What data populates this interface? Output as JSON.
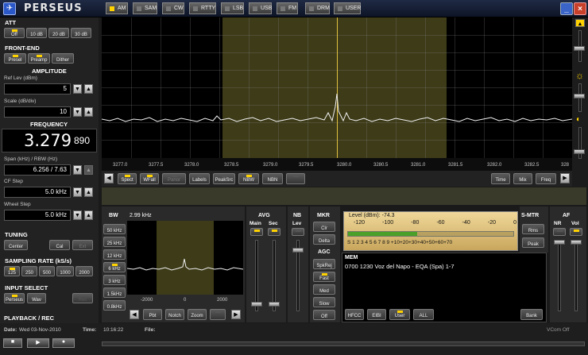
{
  "window": {
    "title": "PERSEUS",
    "min_glyph": "_",
    "close_glyph": "×"
  },
  "left": {
    "att": {
      "title": "ATT",
      "buttons": [
        "Off",
        "10 dB",
        "20 dB",
        "30 dB"
      ]
    },
    "frontend": {
      "title": "FRONT-END",
      "buttons": [
        "Presel",
        "Preamp",
        "Dither"
      ]
    },
    "amplitude": {
      "title": "AMPLITUDE",
      "ref_label": "Ref Lev (dBm)",
      "ref_value": "5",
      "scale_label": "Scale (dB/div)",
      "scale_value": "10"
    },
    "frequency": {
      "title": "FREQUENCY",
      "main": "3.279",
      "fine": "890",
      "span_label": "Span (kHz) / RBW (Hz)",
      "span_value": "6.256 / 7.63",
      "cf_label": "CF Step",
      "cf_value": "5.0 kHz",
      "wheel_label": "Wheel Step",
      "wheel_value": "5.0 kHz"
    },
    "tuning": {
      "title": "TUNING",
      "buttons": [
        "Center",
        "Cal",
        "Ext"
      ]
    },
    "sampling": {
      "title": "SAMPLING RATE (kS/s)",
      "buttons": [
        "125",
        "250",
        "500",
        "1000",
        "2000"
      ]
    },
    "input": {
      "title": "INPUT SELECT",
      "buttons": [
        "Perseus",
        "Wav",
        "Rec"
      ]
    }
  },
  "spectrum": {
    "ticks": [
      "3277.0",
      "3277.5",
      "3278.0",
      "3278.5",
      "3279.0",
      "3279.5",
      "3280.0",
      "3280.5",
      "3281.0",
      "3281.5",
      "3282.0",
      "3282.5",
      "328"
    ],
    "toolbar_left": [
      "Spect",
      "WFall",
      "Panor",
      "Labels",
      "PeakSrc",
      "NBW",
      "NBN",
      ""
    ],
    "toolbar_right": [
      "Time",
      "Mix",
      "Freq"
    ]
  },
  "modes": [
    "AM",
    "SAM",
    "CW",
    "RTTY",
    "LSB",
    "USB",
    "FM",
    "DRM",
    "USER"
  ],
  "bw": {
    "title": "BW",
    "value": "2.99 kHz",
    "buttons": [
      "50 kHz",
      "25 kHz",
      "12 kHz",
      "6 kHz",
      "3 kHz",
      "1.5kHz",
      "0.8kHz"
    ],
    "ticks": [
      "-2000",
      "0",
      "2000"
    ],
    "toolbar": [
      "Pbt",
      "Notch",
      "Zoom"
    ]
  },
  "avg": {
    "title": "AVG",
    "main": "Main",
    "sec": "Sec"
  },
  "nb": {
    "title": "NB",
    "lev": "Lev"
  },
  "mkr": {
    "title": "MKR",
    "buttons": [
      "Clr",
      "Delta"
    ]
  },
  "agc": {
    "title": "AGC",
    "buttons": [
      "SpkRej",
      "Fast",
      "Med",
      "Slow",
      "Off"
    ]
  },
  "level": {
    "label": "Level (dBm): -74.3",
    "top_scale": [
      "-120",
      "-100",
      "-80",
      "-60",
      "-40",
      "-20",
      "0"
    ],
    "bottom_scale": "S 1 2 3 4 5 6 7 8 9 +10+20+30+40+50+60+70",
    "fill_fraction": 0.42
  },
  "smtr": {
    "title": "S-MTR",
    "buttons": [
      "Rms",
      "Peak"
    ]
  },
  "af": {
    "title": "AF",
    "nr": "NR",
    "vol": "Vol"
  },
  "mem": {
    "title": "MEM",
    "entry": "0700 1230 Voz del Napo  - EQA (Spa)  1-7",
    "buttons": [
      "HFCC",
      "EIBI",
      "User",
      "ALL"
    ],
    "bank": "Bank"
  },
  "status": {
    "playback": "PLAYBACK / REC",
    "date_label": "Date:",
    "date": "Wed 03-Nov-2010",
    "time_label": "Time:",
    "time": "10:16:22",
    "file_label": "File:",
    "vcom": "VCom Off"
  }
}
